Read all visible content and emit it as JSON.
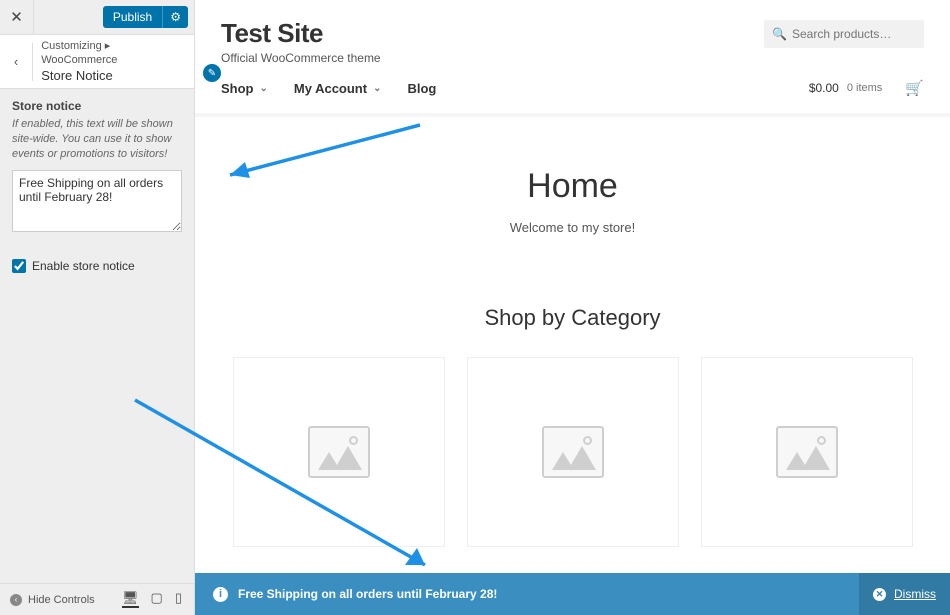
{
  "sidebar": {
    "publish_label": "Publish",
    "crumb_prefix": "Customizing ▸ WooCommerce",
    "crumb_title": "Store Notice",
    "panel_label": "Store notice",
    "panel_desc": "If enabled, this text will be shown site-wide. You can use it to show events or promotions to visitors!",
    "notice_value": "Free Shipping on all orders until February 28!",
    "enable_label": "Enable store notice",
    "hide_controls": "Hide Controls"
  },
  "site": {
    "title": "Test Site",
    "tagline": "Official WooCommerce theme",
    "search_placeholder": "Search products…"
  },
  "nav": {
    "items": [
      {
        "label": "Shop",
        "has_children": true
      },
      {
        "label": "My Account",
        "has_children": true
      },
      {
        "label": "Blog",
        "has_children": false
      }
    ],
    "cart_amount": "$0.00",
    "cart_items": "0 items"
  },
  "page": {
    "home_title": "Home",
    "home_sub": "Welcome to my store!",
    "cat_title": "Shop by Category"
  },
  "notice_bar": {
    "text": "Free Shipping on all orders until February 28!",
    "dismiss": "Dismiss"
  }
}
